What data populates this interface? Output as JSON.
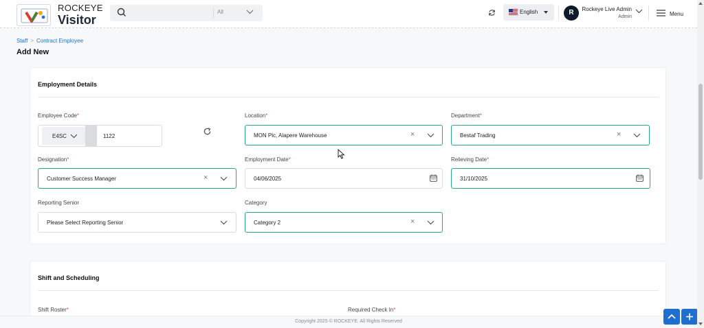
{
  "header": {
    "brand_top": "ROCKEYE",
    "brand_bottom": "Visitor",
    "search_placeholder": "",
    "search_scope": "All",
    "language": "English",
    "user_name": "Rockeye Live Admin",
    "user_role": "Admin",
    "avatar_initial": "R",
    "menu_label": "Menu"
  },
  "breadcrumb": {
    "items": [
      "Staff",
      "Contract Employee"
    ],
    "separator": ">"
  },
  "page_title": "Add New",
  "employment": {
    "title": "Employment Details",
    "employee_code_label": "Employee Code",
    "employee_code_prefix": "E4SC",
    "employee_code_value": "1122",
    "location_label": "Location",
    "location_value": "MON Plc, Alapere Warehouse",
    "department_label": "Department",
    "department_value": "Bestaf Trading",
    "designation_label": "Designation",
    "designation_value": "Customer Success Manager",
    "employment_date_label": "Employment Date",
    "employment_date_value": "04/06/2025",
    "relieving_date_label": "Relieving Date",
    "relieving_date_value": "31/10/2025",
    "reporting_senior_label": "Reporting Senior",
    "reporting_senior_value": "Please Select Reporting Senior",
    "category_label": "Category",
    "category_value": "Category 2",
    "required_marker": "*"
  },
  "shift": {
    "title": "Shift and Scheduling",
    "shift_roster_label": "Shift Roster",
    "required_checkin_label": "Required Check In"
  },
  "footer": {
    "copyright": "Copyright 2025 © ROCKEYE. All Rights Reserved"
  },
  "colors": {
    "accent": "#2aa48f",
    "primary": "#1f6fd1",
    "required": "#d9534f"
  },
  "icons": [
    "search-icon",
    "chevron-down-icon",
    "refresh-icon",
    "us-flag-icon",
    "hamburger-icon",
    "regenerate-icon",
    "clear-icon",
    "calendar-icon",
    "arrow-up-icon",
    "plus-icon"
  ]
}
